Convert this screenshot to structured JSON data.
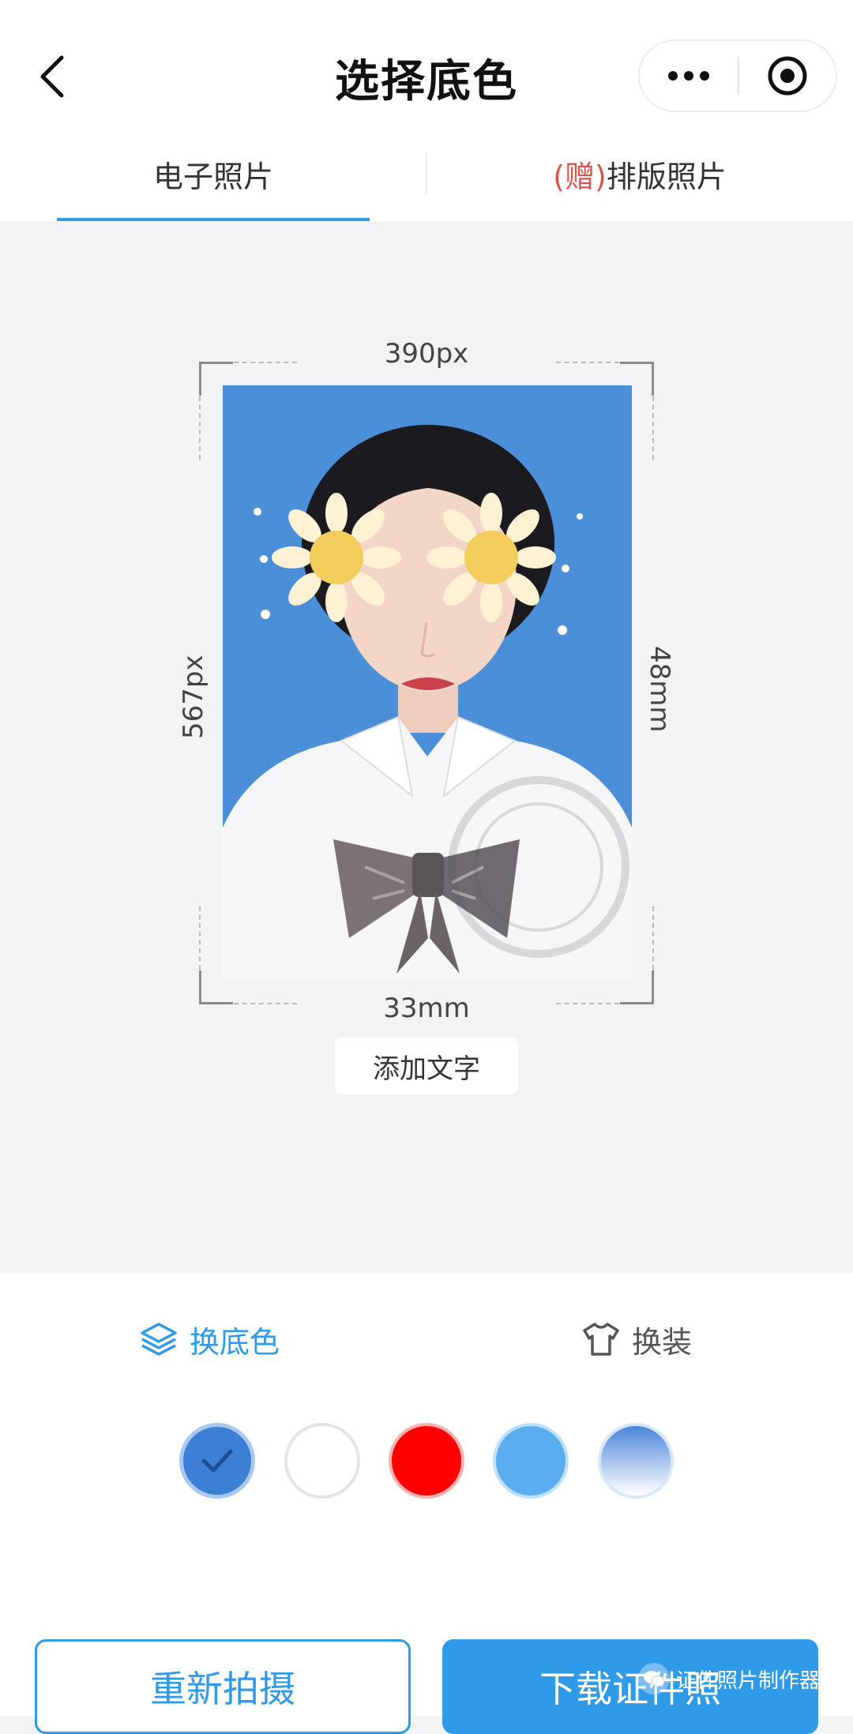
{
  "header": {
    "title": "选择底色",
    "back_icon": "chevron-left-icon",
    "more_icon": "more-dots-icon",
    "close_icon": "target-icon"
  },
  "tabs": {
    "electronic": "电子照片",
    "gift_prefix": "(赠)",
    "layout": "排版照片",
    "active": "electronic"
  },
  "photo": {
    "width_px": "390px",
    "height_px": "567px",
    "width_mm": "33mm",
    "height_mm": "48mm",
    "background_color": "#4a8fd8",
    "add_text": "添加文字"
  },
  "panel": {
    "change_bg": "换底色",
    "change_clothes": "换装",
    "change_bg_icon": "layers-icon",
    "change_clothes_icon": "tshirt-icon",
    "swatches": [
      {
        "name": "blue",
        "color": "#3c80d6",
        "selected": true
      },
      {
        "name": "white",
        "color": "#ffffff",
        "selected": false
      },
      {
        "name": "red",
        "color": "#ff0000",
        "selected": false
      },
      {
        "name": "light-blue",
        "color": "#5aaef0",
        "selected": false
      },
      {
        "name": "blue-gradient",
        "color": "#4a86d8",
        "selected": false
      }
    ]
  },
  "actions": {
    "retake": "重新拍摄",
    "download": "下载证件照"
  },
  "watermark": {
    "text": "证件照片制作器"
  },
  "colors": {
    "accent": "#2f9ae8",
    "canvas_bg": "#f2f3f5"
  }
}
